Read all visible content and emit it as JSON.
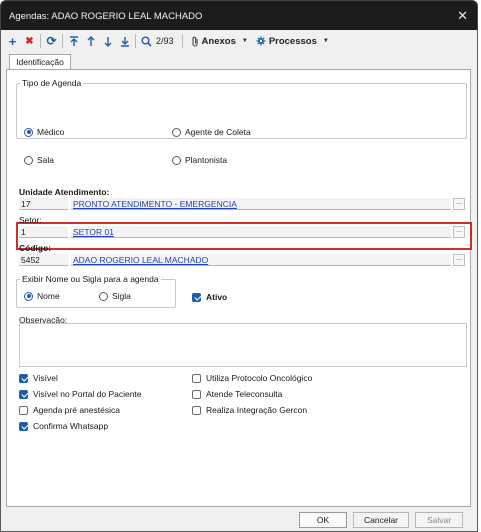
{
  "window": {
    "title": "Agendas: ADAO ROGERIO LEAL MACHADO",
    "close_glyph": "✕"
  },
  "toolbar": {
    "buttons": [
      {
        "name": "add-icon",
        "glyph": "+"
      },
      {
        "name": "delete-icon",
        "glyph": "✖"
      },
      {
        "name": "refresh-icon",
        "glyph": "⟳"
      },
      {
        "name": "first-record-icon"
      },
      {
        "name": "previous-record-icon"
      },
      {
        "name": "next-record-icon"
      },
      {
        "name": "last-record-icon"
      },
      {
        "name": "search-icon"
      }
    ],
    "record_counter": "2/93",
    "anexos_label": "Anexos",
    "processos_label": "Processos",
    "accent_color": "#1f5fa8"
  },
  "tabs": {
    "identificacao": "Identificação"
  },
  "tipo_agenda": {
    "label": "Tipo de Agenda",
    "options": {
      "medico": "Médico",
      "agente_coleta": "Agente de Coleta",
      "sala": "Sala",
      "plantonista": "Plantonista"
    },
    "selected": "Médico"
  },
  "unidade": {
    "label": "Unidade Atendimento:",
    "code": "17",
    "name": "PRONTO ATENDIMENTO - EMERGENCIA"
  },
  "setor": {
    "label": "Setor:",
    "code": "1",
    "name": "SETOR 01",
    "highlight_color": "#d42b2b"
  },
  "codigo": {
    "label": "Código:",
    "code": "5452",
    "name": "ADAO ROGERIO LEAL MACHADO"
  },
  "exibir": {
    "label": "Exibir Nome ou Sigla para a agenda",
    "nome": "Nome",
    "sigla": "Sigla",
    "selected": "Nome"
  },
  "ativo": {
    "label": "Ativo",
    "checked": true
  },
  "observacao": {
    "label": "Observação:",
    "value": ""
  },
  "checkboxes": {
    "visivel": {
      "label": "Visível",
      "checked": true
    },
    "visivel_portal": {
      "label": "Visível no Portal do Paciente",
      "checked": true
    },
    "pre_anestesica": {
      "label": "Agenda pré anestésica",
      "checked": false
    },
    "confirma_whatsapp": {
      "label": "Confirma Whatsapp",
      "checked": true
    },
    "protocolo_oncologico": {
      "label": "Utiliza Protocolo Oncológico",
      "checked": false
    },
    "teleconsulta": {
      "label": "Atende Teleconsulta",
      "checked": false
    },
    "gercon": {
      "label": "Realiza Integração Gercon",
      "checked": false
    }
  },
  "buttons": {
    "ok": "OK",
    "cancelar": "Cancelar",
    "salvar": "Salvar",
    "ellipsis": "..."
  }
}
